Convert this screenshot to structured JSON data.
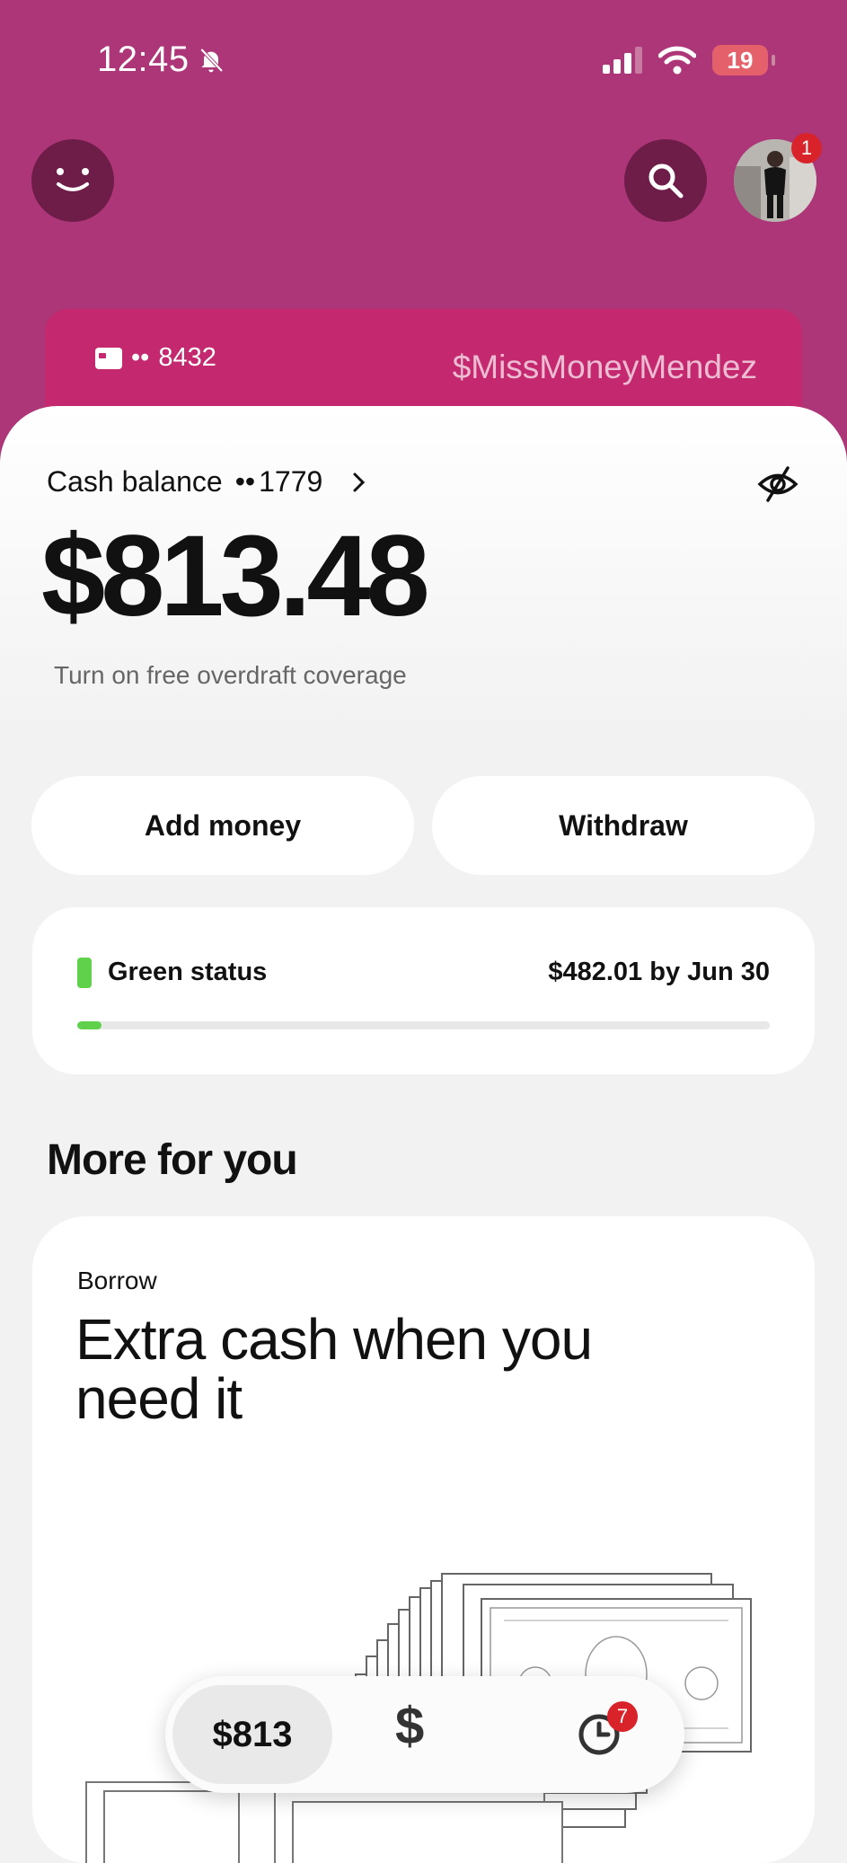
{
  "status_bar": {
    "time": "12:45",
    "battery": "19"
  },
  "card": {
    "last_digits": "8432",
    "dots": "••",
    "cashtag": "$MissMoneyMendez"
  },
  "avatar": {
    "notification_count": "1"
  },
  "balance": {
    "label": "Cash balance",
    "dots": "••",
    "account_last_digits": "1779",
    "amount": "$813.48",
    "overdraft_link": "Turn on free overdraft coverage"
  },
  "actions": {
    "add_money": "Add money",
    "withdraw": "Withdraw"
  },
  "green_status": {
    "label": "Green status",
    "value": "$482.01 by Jun 30",
    "progress_percent": 3.5,
    "color": "#5fd14a"
  },
  "more_for_you": {
    "title": "More for you",
    "borrow": {
      "kicker": "Borrow",
      "title": "Extra cash when you need it"
    }
  },
  "bottom_nav": {
    "money_label": "$813",
    "pay_label": "$",
    "activity_badge": "7"
  },
  "colors": {
    "header": "#ad3679",
    "card": "#c4286e",
    "accent_green": "#5fd14a",
    "badge_red": "#d8232a"
  },
  "icons": [
    "smiley-icon",
    "search-icon",
    "card-icon",
    "chevron-right-icon",
    "eye-off-icon",
    "clock-icon",
    "bell-slash-icon",
    "signal-icon",
    "wifi-icon"
  ]
}
